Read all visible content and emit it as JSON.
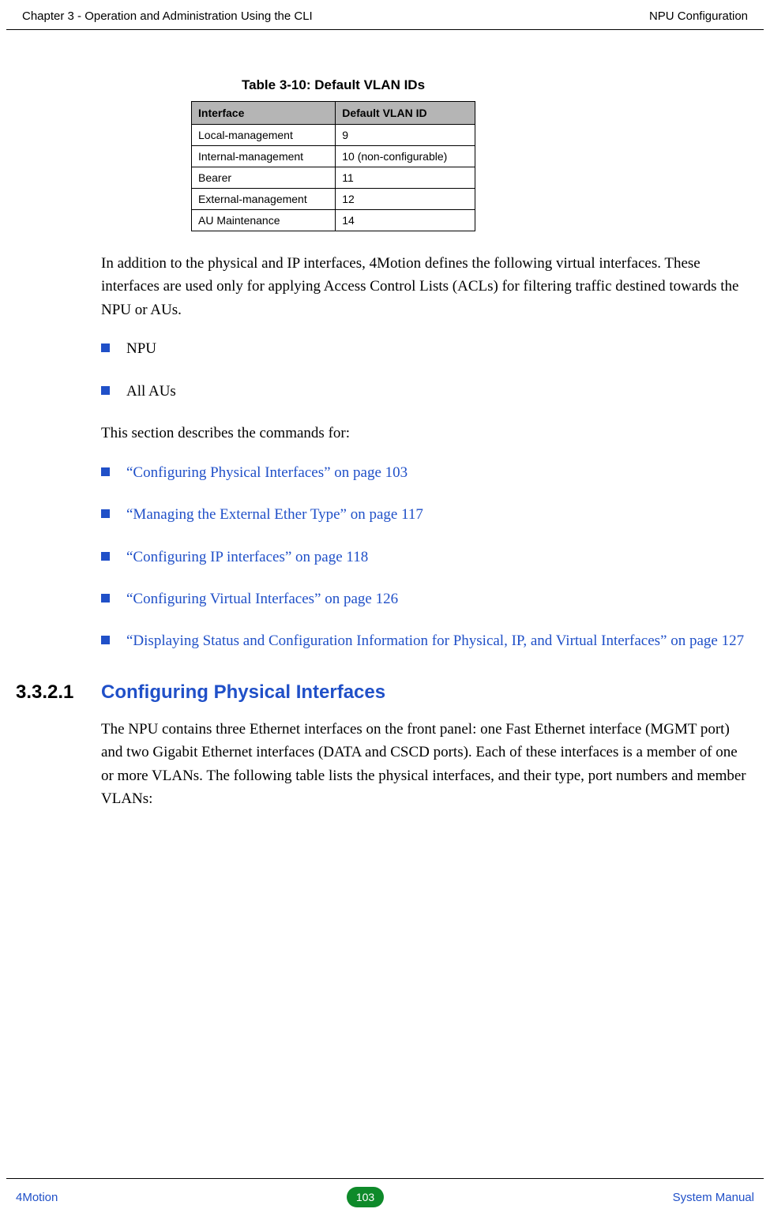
{
  "header": {
    "left": "Chapter 3 - Operation and Administration Using the CLI",
    "right": "NPU Configuration"
  },
  "table": {
    "caption": "Table 3-10: Default VLAN IDs",
    "head": {
      "c1": "Interface",
      "c2": "Default VLAN ID"
    },
    "rows": [
      {
        "c1": "Local-management",
        "c2": "9"
      },
      {
        "c1": "Internal-management",
        "c2": "10 (non-configurable)"
      },
      {
        "c1": "Bearer",
        "c2": "11"
      },
      {
        "c1": "External-management",
        "c2": "12"
      },
      {
        "c1": "AU Maintenance",
        "c2": "14"
      }
    ]
  },
  "para1": "In addition to the physical and IP interfaces, 4Motion defines the following virtual interfaces. These interfaces are used only for applying Access Control Lists (ACLs) for filtering traffic destined towards the NPU or AUs.",
  "bullets1": [
    "NPU",
    "All AUs"
  ],
  "para2": "This section describes the commands for:",
  "bullets2": [
    "“Configuring Physical Interfaces” on page 103",
    "“Managing the External Ether Type” on page 117",
    "“Configuring IP interfaces” on page 118",
    "“Configuring Virtual Interfaces” on page 126",
    "“Displaying Status and Configuration Information for Physical, IP, and Virtual Interfaces” on page 127"
  ],
  "section": {
    "num": "3.3.2.1",
    "title": "Configuring Physical Interfaces"
  },
  "para3": "The NPU contains three Ethernet interfaces on the front panel: one Fast Ethernet interface (MGMT port) and two Gigabit Ethernet interfaces (DATA and CSCD ports). Each of these interfaces is a member of one or more VLANs. The following table lists the physical interfaces, and their type, port numbers and member VLANs:",
  "footer": {
    "left": "4Motion",
    "page": "103",
    "right": "System Manual"
  },
  "chart_data": {
    "type": "table",
    "title": "Table 3-10: Default VLAN IDs",
    "columns": [
      "Interface",
      "Default VLAN ID"
    ],
    "rows": [
      [
        "Local-management",
        "9"
      ],
      [
        "Internal-management",
        "10 (non-configurable)"
      ],
      [
        "Bearer",
        "11"
      ],
      [
        "External-management",
        "12"
      ],
      [
        "AU Maintenance",
        "14"
      ]
    ]
  }
}
